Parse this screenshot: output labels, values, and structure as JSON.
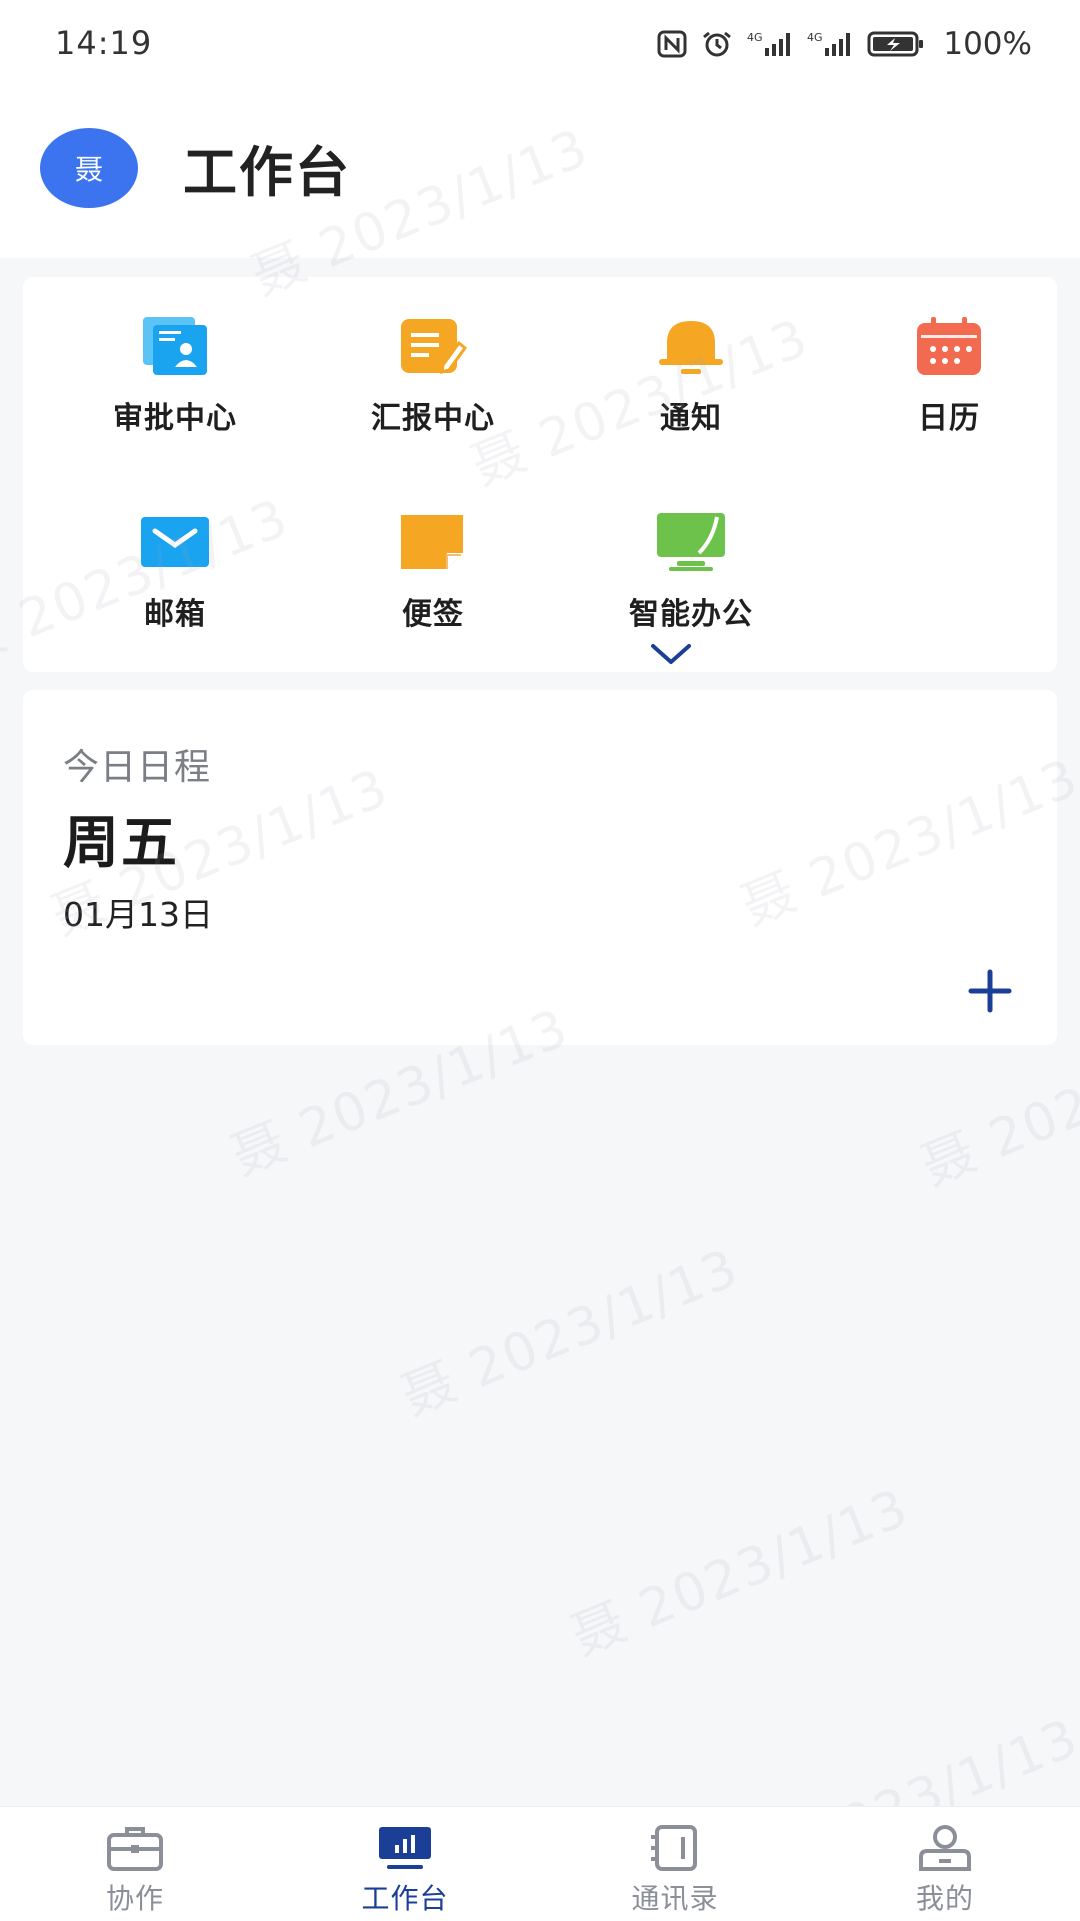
{
  "status_bar": {
    "time": "14:19",
    "battery": "100%",
    "icons": [
      "nfc-icon",
      "alarm-icon",
      "signal-4g-icon",
      "signal-4g-icon",
      "battery-charging-icon"
    ]
  },
  "header": {
    "avatar_text": "聂",
    "title": "工作台"
  },
  "apps": [
    {
      "label": "审批中心",
      "icon": "approval-icon",
      "color": "#1aa4f0"
    },
    {
      "label": "汇报中心",
      "icon": "report-icon",
      "color": "#f5a623"
    },
    {
      "label": "通知",
      "icon": "bell-icon",
      "color": "#f5a623"
    },
    {
      "label": "日历",
      "icon": "calendar-icon",
      "color": "#f26a4f"
    },
    {
      "label": "邮箱",
      "icon": "mail-icon",
      "color": "#1aa4f0"
    },
    {
      "label": "便签",
      "icon": "sticky-note-icon",
      "color": "#f5a623"
    },
    {
      "label": "智能办公",
      "icon": "monitor-icon",
      "color": "#6cc24a"
    }
  ],
  "schedule": {
    "title": "今日日程",
    "weekday": "周五",
    "date": "01月13日"
  },
  "watermark": "聂 2023/1/13",
  "bottom_nav": [
    {
      "label": "协作",
      "icon": "briefcase-icon",
      "active": false
    },
    {
      "label": "工作台",
      "icon": "workbench-icon",
      "active": true
    },
    {
      "label": "通讯录",
      "icon": "contacts-icon",
      "active": false
    },
    {
      "label": "我的",
      "icon": "profile-icon",
      "active": false
    }
  ],
  "colors": {
    "accent": "#1b3f97",
    "avatar": "#3b74ee",
    "background": "#f6f7f9"
  }
}
